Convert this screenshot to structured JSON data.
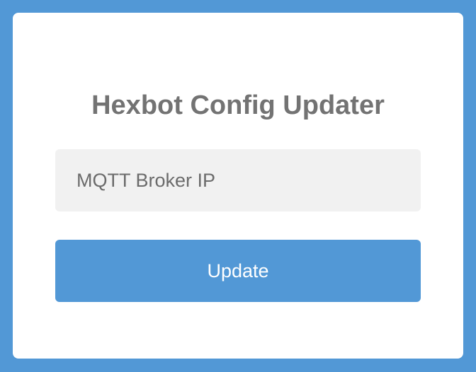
{
  "app": {
    "title": "Hexbot Config Updater"
  },
  "form": {
    "broker_ip": {
      "value": "",
      "placeholder": "MQTT Broker IP"
    },
    "submit_label": "Update"
  },
  "colors": {
    "background": "#5298d6",
    "card": "#ffffff",
    "title_text": "#737373",
    "input_background": "#f1f1f1",
    "input_text": "#6b6b6b",
    "button_background": "#5298d6",
    "button_text": "#ffffff"
  }
}
